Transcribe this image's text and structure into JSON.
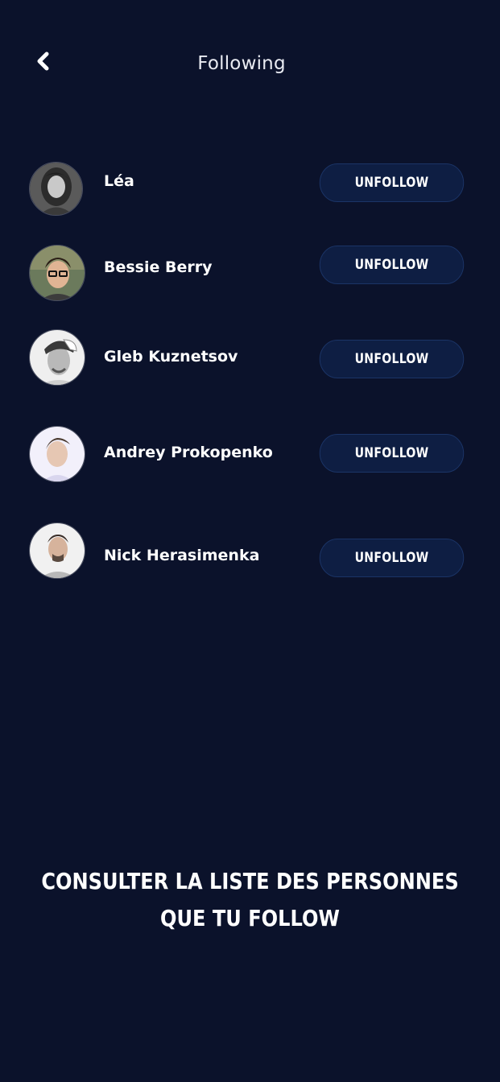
{
  "header": {
    "title": "Following",
    "back_icon": "chevron-left-icon"
  },
  "following": [
    {
      "name": "Léa",
      "button_label": "UNFOLLOW",
      "avatar": "avatar-photo"
    },
    {
      "name": "Bessie Berry",
      "button_label": "UNFOLLOW",
      "avatar": "avatar-photo"
    },
    {
      "name": "Gleb Kuznetsov",
      "button_label": "UNFOLLOW",
      "avatar": "avatar-photo"
    },
    {
      "name": "Andrey Prokopenko",
      "button_label": "UNFOLLOW",
      "avatar": "avatar-photo"
    },
    {
      "name": "Nick Herasimenka",
      "button_label": "UNFOLLOW",
      "avatar": "avatar-photo"
    }
  ],
  "caption": {
    "line1": "CONSULTER LA LISTE DES PERSONNES",
    "line2": "QUE TU FOLLOW"
  },
  "colors": {
    "background": "#0b122b",
    "button_bg": "#0e1e43",
    "button_border": "#1b3466",
    "text": "#ffffff"
  }
}
